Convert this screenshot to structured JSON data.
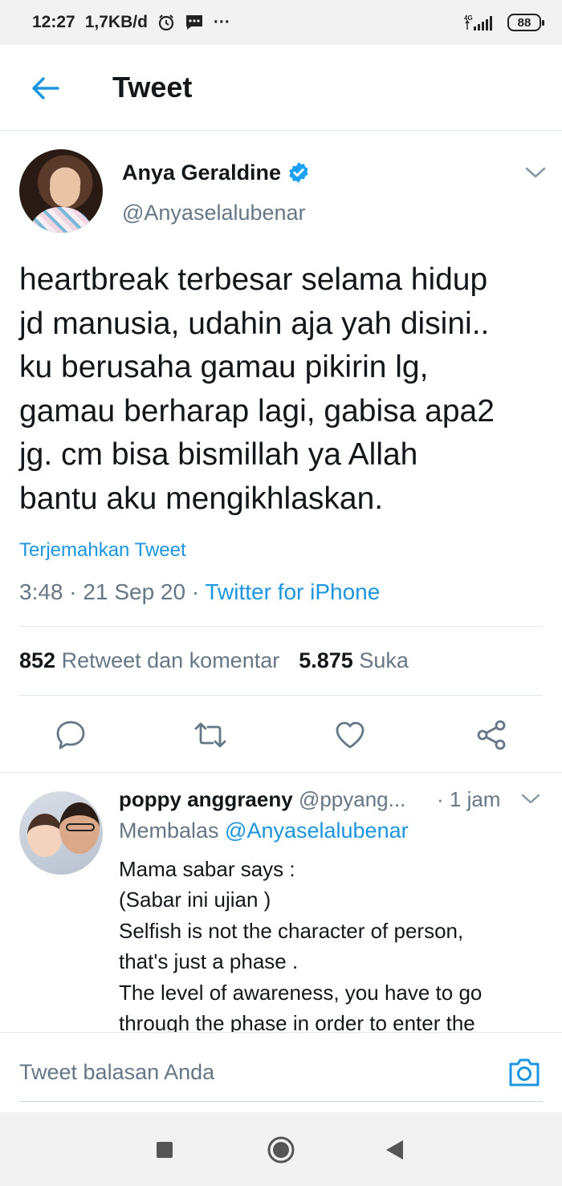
{
  "status_bar": {
    "time": "12:27",
    "data_rate": "1,7KB/d",
    "more": "···",
    "network": "4G",
    "battery": "88"
  },
  "header": {
    "title": "Tweet"
  },
  "tweet": {
    "author_name": "Anya Geraldine",
    "author_handle": "@Anyaselalubenar",
    "text_lines": [
      "heartbreak terbesar selama hidup",
      "jd manusia, udahin aja yah disini..",
      "ku berusaha gamau pikirin lg,",
      "gamau berharap lagi, gabisa apa2",
      "jg. cm bisa bismillah ya Allah",
      "bantu aku mengikhlaskan."
    ],
    "translate_label": "Terjemahkan Tweet",
    "time": "3:48",
    "date": "21 Sep 20",
    "source": "Twitter for iPhone",
    "separator": " · ",
    "retweets_count": "852",
    "retweets_label": "Retweet dan komentar",
    "likes_count": "5.875",
    "likes_label": "Suka"
  },
  "reply": {
    "name": "poppy anggraeny",
    "handle": "@ppyang...",
    "time": "· 1 jam",
    "replying_prefix": "Membalas ",
    "replying_to": "@Anyaselalubenar",
    "lines": [
      "Mama sabar says :",
      "(Sabar ini ujian )",
      "Selfish is not the character of person,",
      "that's just a phase .",
      "The level of awareness, you have to go",
      "through the phase in order to enter the"
    ]
  },
  "compose": {
    "placeholder": "Tweet balasan Anda"
  },
  "colors": {
    "accent": "#1b95e0",
    "secondary_text": "#657786",
    "primary_text": "#14171a",
    "divider": "#e1e8ed"
  },
  "icons": {
    "back": "arrow-left-icon",
    "verified": "verified-badge-icon",
    "menu": "chevron-down-icon",
    "reply": "comment-icon",
    "retweet": "retweet-icon",
    "like": "heart-icon",
    "share": "share-icon",
    "camera": "camera-icon"
  }
}
